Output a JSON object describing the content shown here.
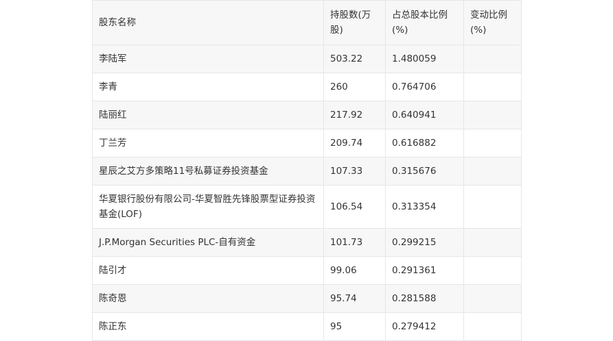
{
  "table": {
    "headers": [
      "股东名称",
      "持股数(万股)",
      "占总股本比例(%)",
      "变动比例(%)"
    ],
    "rows": [
      {
        "name": "李陆军",
        "shares": "503.22",
        "ratio": "1.480059",
        "change": ""
      },
      {
        "name": "李青",
        "shares": "260",
        "ratio": "0.764706",
        "change": ""
      },
      {
        "name": "陆丽红",
        "shares": "217.92",
        "ratio": "0.640941",
        "change": ""
      },
      {
        "name": "丁兰芳",
        "shares": "209.74",
        "ratio": "0.616882",
        "change": ""
      },
      {
        "name": "星辰之艾方多策略11号私募证券投资基金",
        "shares": "107.33",
        "ratio": "0.315676",
        "change": ""
      },
      {
        "name": "华夏银行股份有限公司-华夏智胜先锋股票型证券投资基金(LOF)",
        "shares": "106.54",
        "ratio": "0.313354",
        "change": ""
      },
      {
        "name": "J.P.Morgan Securities PLC-自有资金",
        "shares": "101.73",
        "ratio": "0.299215",
        "change": ""
      },
      {
        "name": "陆引才",
        "shares": "99.06",
        "ratio": "0.291361",
        "change": ""
      },
      {
        "name": "陈奇恩",
        "shares": "95.74",
        "ratio": "0.281588",
        "change": ""
      },
      {
        "name": "陈正东",
        "shares": "95",
        "ratio": "0.279412",
        "change": ""
      }
    ]
  }
}
